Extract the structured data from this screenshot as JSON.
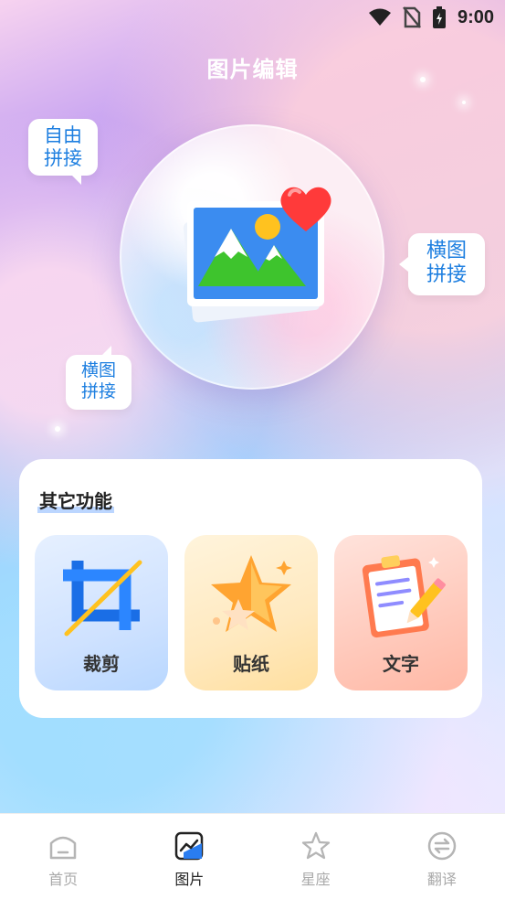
{
  "status_bar": {
    "time": "9:00"
  },
  "page": {
    "title": "图片编辑"
  },
  "tags": {
    "free": [
      "自由",
      "拼接"
    ],
    "horizontal": [
      "横图",
      "拼接"
    ],
    "horizontal2": [
      "横图",
      "拼接"
    ]
  },
  "features": {
    "title": "其它功能",
    "items": [
      {
        "label": "裁剪",
        "icon": "crop-icon"
      },
      {
        "label": "贴纸",
        "icon": "star-sticker-icon"
      },
      {
        "label": "文字",
        "icon": "clipboard-pencil-icon"
      }
    ]
  },
  "nav": {
    "items": [
      {
        "label": "首页",
        "icon": "home-icon",
        "active": false
      },
      {
        "label": "图片",
        "icon": "image-chart-icon",
        "active": true
      },
      {
        "label": "星座",
        "icon": "star-icon",
        "active": false
      },
      {
        "label": "翻译",
        "icon": "exchange-icon",
        "active": false
      }
    ]
  },
  "colors": {
    "accent": "#1e7fe0",
    "nav_active": "#222222",
    "nav_inactive": "#aaaaaa"
  }
}
